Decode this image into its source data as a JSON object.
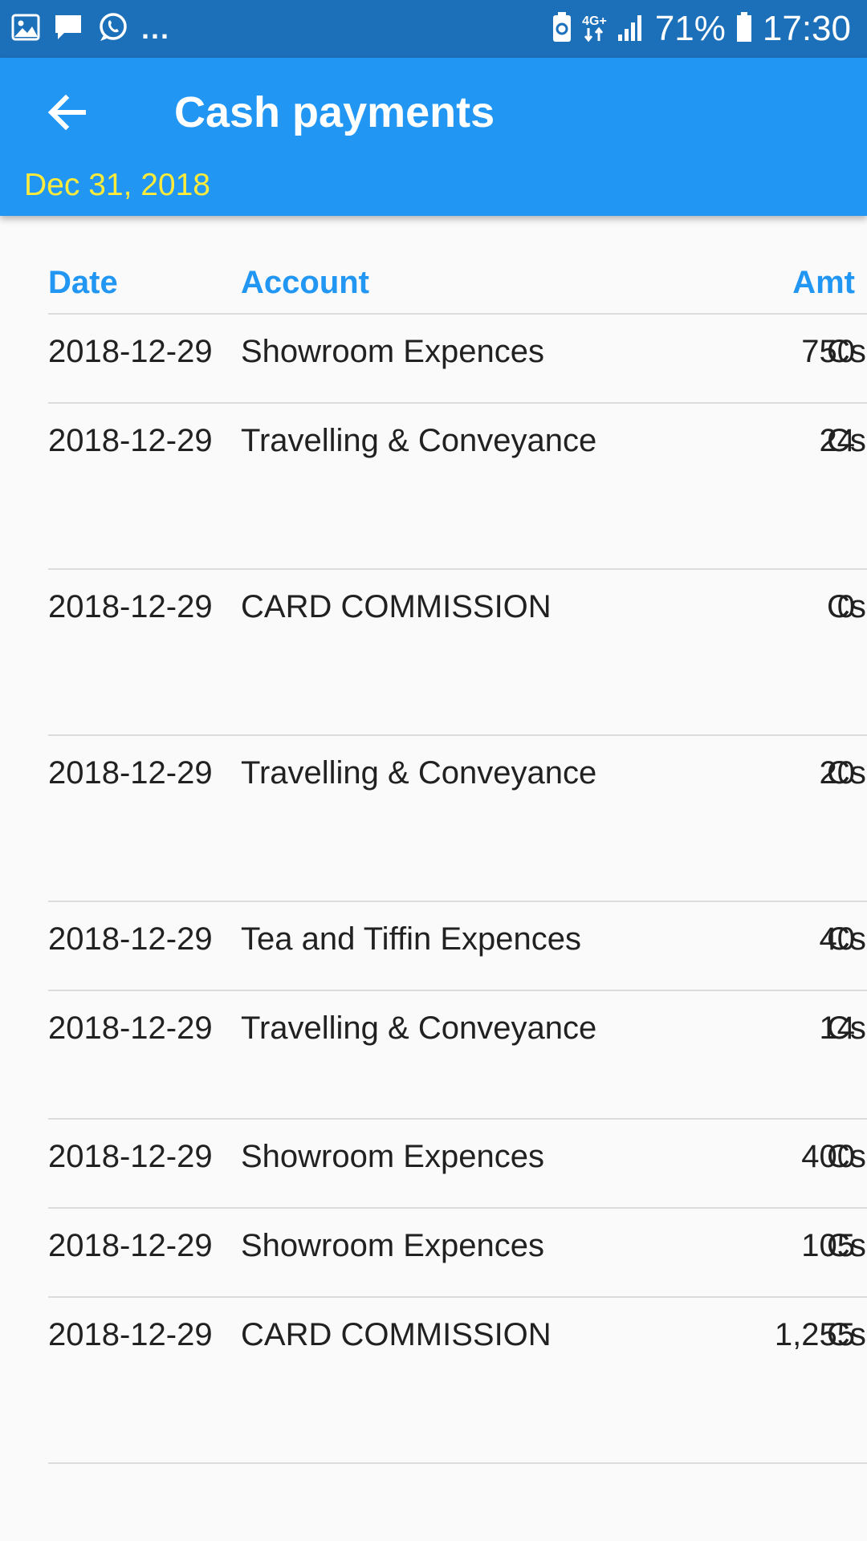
{
  "status_bar": {
    "battery_percent": "71%",
    "time": "17:30",
    "more_indicator": "...",
    "network_label": "4G+"
  },
  "app_bar": {
    "title": "Cash payments",
    "date": "Dec 31, 2018",
    "color": "#2196f3",
    "date_color": "#ffeb3b"
  },
  "table": {
    "headers": {
      "date": "Date",
      "account": "Account",
      "amount": "Amt"
    },
    "rows": [
      {
        "date": "2018-12-29",
        "account": "Showroom Expences",
        "amount": "750",
        "type": "Cs"
      },
      {
        "date": "2018-12-29",
        "account": "Travelling & Conveyance",
        "amount": "24",
        "type": "Cs"
      },
      {
        "date": "2018-12-29",
        "account": "CARD COMMISSION",
        "amount": "0",
        "type": "Cs"
      },
      {
        "date": "2018-12-29",
        "account": "Travelling & Conveyance",
        "amount": "20",
        "type": "Cs"
      },
      {
        "date": "2018-12-29",
        "account": "Tea and Tiffin Expences",
        "amount": "40",
        "type": "Cs"
      },
      {
        "date": "2018-12-29",
        "account": "Travelling & Conveyance",
        "amount": "14",
        "type": "Cs"
      },
      {
        "date": "2018-12-29",
        "account": "Showroom Expences",
        "amount": "400",
        "type": "Cs"
      },
      {
        "date": "2018-12-29",
        "account": "Showroom Expences",
        "amount": "105",
        "type": "Cs"
      },
      {
        "date": "2018-12-29",
        "account": "CARD COMMISSION",
        "amount": "1,255",
        "type": "Cs"
      }
    ]
  },
  "icons": {
    "status_left": [
      "gallery-icon",
      "message-icon",
      "whatsapp-icon"
    ],
    "status_right": [
      "battery-saver-icon",
      "network-4g-icon",
      "signal-icon",
      "battery-icon"
    ],
    "app_bar": "back-arrow-icon"
  }
}
